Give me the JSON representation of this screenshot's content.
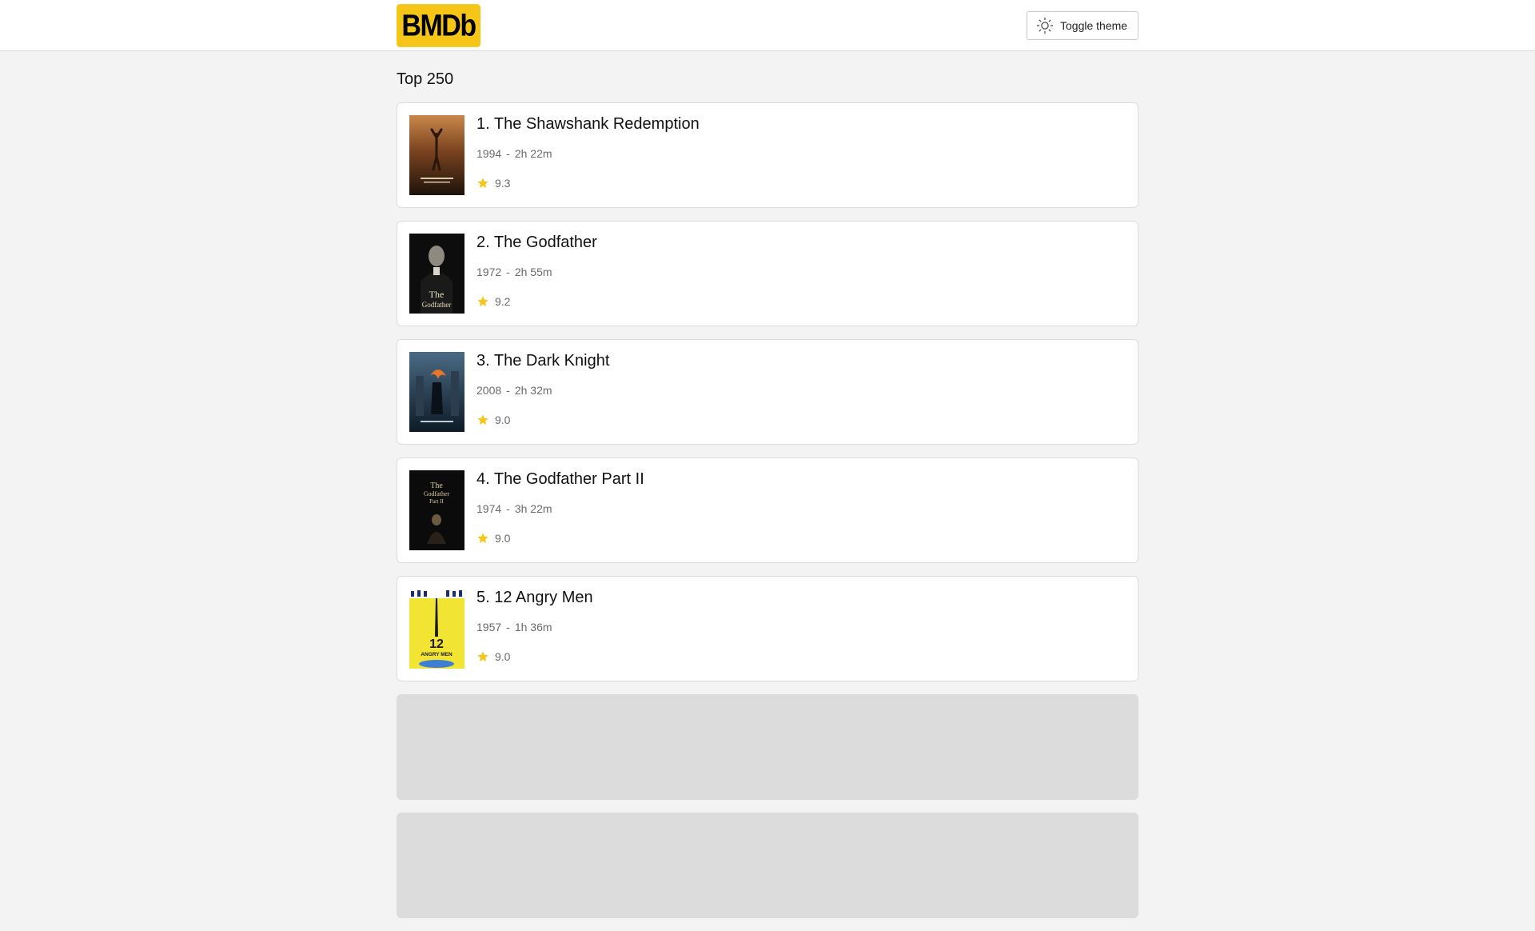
{
  "header": {
    "logo_text": "BMDb",
    "theme_button_label": "Toggle theme",
    "theme_icon": "sun-icon"
  },
  "page": {
    "title": "Top 250"
  },
  "colors": {
    "accent": "#f5c518",
    "background": "#f3f3f3",
    "card": "#ffffff",
    "skeleton": "#dcdcdc"
  },
  "movies": [
    {
      "rank_title": "1. The Shawshank Redemption",
      "year": "1994",
      "sep": "-",
      "runtime": "2h 22m",
      "rating": "9.3",
      "star_icon": "star-icon"
    },
    {
      "rank_title": "2. The Godfather",
      "year": "1972",
      "sep": "-",
      "runtime": "2h 55m",
      "rating": "9.2",
      "star_icon": "star-icon"
    },
    {
      "rank_title": "3. The Dark Knight",
      "year": "2008",
      "sep": "-",
      "runtime": "2h 32m",
      "rating": "9.0",
      "star_icon": "star-icon"
    },
    {
      "rank_title": "4. The Godfather Part II",
      "year": "1974",
      "sep": "-",
      "runtime": "3h 22m",
      "rating": "9.0",
      "star_icon": "star-icon"
    },
    {
      "rank_title": "5. 12 Angry Men",
      "year": "1957",
      "sep": "-",
      "runtime": "1h 36m",
      "rating": "9.0",
      "star_icon": "star-icon"
    }
  ]
}
